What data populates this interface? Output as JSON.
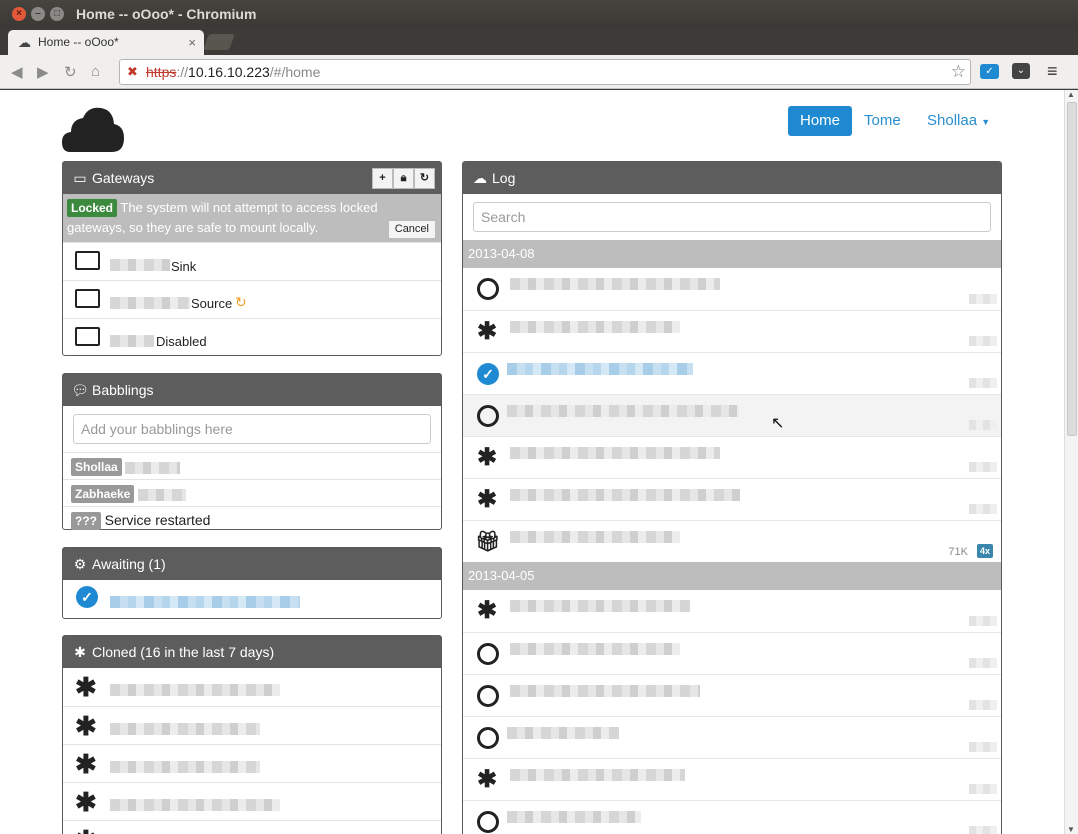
{
  "window": {
    "title": "Home -- oOoo* - Chromium"
  },
  "browser": {
    "tab_title": "Home -- oOoo*",
    "tab_close": "×",
    "url_scheme": "https",
    "url_host": "10.16.10.223",
    "url_path": "/#/home"
  },
  "nav": {
    "home": "Home",
    "tome": "Tome",
    "user": "Shollaa"
  },
  "gateways": {
    "title": "Gateways",
    "locked_label": "Locked",
    "locked_text": "The system will not attempt to access locked gateways, so they are safe to mount locally.",
    "cancel": "Cancel",
    "items": [
      {
        "label": "Sink"
      },
      {
        "label": "Source"
      },
      {
        "label": "Disabled"
      }
    ]
  },
  "babblings": {
    "title": "Babblings",
    "placeholder": "Add your babblings here",
    "entries": [
      {
        "user": "Shollaa",
        "text": ""
      },
      {
        "user": "Zabhaeke",
        "text": ""
      },
      {
        "user": "???",
        "text": "Service restarted"
      }
    ]
  },
  "awaiting": {
    "title": "Awaiting (1)"
  },
  "cloned": {
    "title": "Cloned (16 in the last 7 days)"
  },
  "log": {
    "title": "Log",
    "search_placeholder": "Search",
    "groups": [
      {
        "date": "2013-04-08",
        "gift_size": "71K",
        "gift_badge": "4x"
      },
      {
        "date": "2013-04-05"
      }
    ]
  },
  "icons": {
    "gateways": "hdd-icon",
    "babblings": "comment-icon",
    "awaiting": "cogs-icon",
    "cloned": "asterisk-icon",
    "log": "cloud-download-icon"
  },
  "colors": {
    "accent": "#1f8ad2",
    "panel_header": "#5d5d5d",
    "locked": "#3c8a3e",
    "user_label": "#999999",
    "sync": "#f0a020"
  }
}
